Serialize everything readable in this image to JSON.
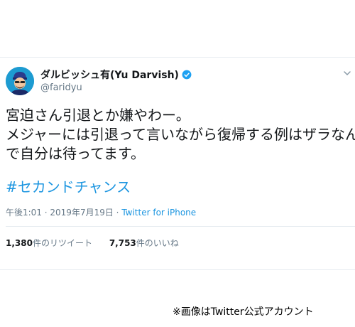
{
  "tweet": {
    "display_name": "ダルビッシュ有(Yu Darvish)",
    "handle": "@faridyu",
    "text_lines": [
      "宮迫さん引退とか嫌やわー。",
      "メジャーには引退って言いながら復帰する例はザラなん",
      "で自分は待ってます。"
    ],
    "hashtag": "#セカンドチャンス",
    "time": "午後1:01",
    "date_sep": " · ",
    "date": "2019年7月19日",
    "source": "Twitter for iPhone",
    "retweet_count": "1,380",
    "retweet_label": "件のリツイート",
    "like_count": "7,753",
    "like_label": "件のいいね"
  },
  "credit": "※画像はTwitter公式アカウント",
  "colors": {
    "link": "#1b95e0",
    "muted": "#657786",
    "avatar_bg": "#1d9bd1",
    "verified": "#1da1f2"
  }
}
